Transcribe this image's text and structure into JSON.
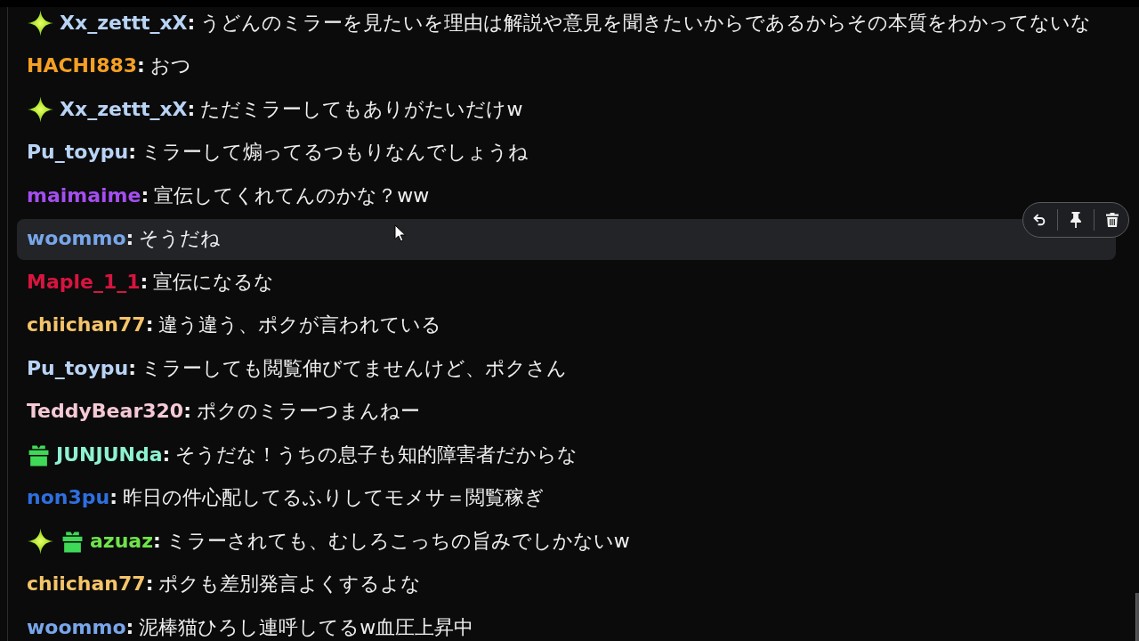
{
  "messages": [
    {
      "badges": [
        {
          "kind": "sparkle"
        }
      ],
      "user": "Xx_zettt_xX",
      "separator": ":",
      "color": "#b9d3f5",
      "text": "うどんのミラーを見たいを理由は解説や意見を聞きたいからであるからその本質をわかってないな",
      "hovered": false
    },
    {
      "user": "HACHI883",
      "separator": ":",
      "color": "#f5a023",
      "text": "おつ",
      "hovered": false
    },
    {
      "badges": [
        {
          "kind": "sparkle"
        }
      ],
      "user": "Xx_zettt_xX",
      "separator": ":",
      "color": "#b9d3f5",
      "text": "ただミラーしてもありがたいだけw",
      "hovered": false
    },
    {
      "user": "Pu_toypu",
      "separator": ":",
      "color": "#b9d3f5",
      "text": "ミラーして煽ってるつもりなんでしょうね",
      "hovered": false
    },
    {
      "user": "maimaime",
      "separator": ":",
      "color": "#a44ef0",
      "text": "宣伝してくれてんのかな？ww",
      "hovered": false
    },
    {
      "user": "woommo",
      "separator": ":",
      "color": "#78a6ea",
      "text": "そうだね",
      "hovered": true
    },
    {
      "user": "Maple_1_1",
      "separator": ":",
      "color": "#d81440",
      "text": "宣伝になるな",
      "hovered": false
    },
    {
      "user": "chiichan77",
      "separator": ":",
      "color": "#f5c46a",
      "text": "違う違う、ポクが言われている",
      "hovered": false
    },
    {
      "user": "Pu_toypu",
      "separator": ":",
      "color": "#b9d3f5",
      "text": "ミラーしても閲覧伸びてませんけど、ポクさん",
      "hovered": false
    },
    {
      "user": "TeddyBear320",
      "separator": ":",
      "color": "#f5c9d5",
      "text": "ポクのミラーつまんねー",
      "hovered": false
    },
    {
      "badges": [
        {
          "kind": "gift"
        }
      ],
      "user": "JUNJUNda",
      "separator": ":",
      "color": "#8ef2d2",
      "text": "そうだな！うちの息子も知的障害者だからな",
      "hovered": false
    },
    {
      "user": "non3pu",
      "separator": ":",
      "color": "#2e6fe0",
      "text": "昨日の件心配してるふりしてモメサ＝閲覧稼ぎ",
      "hovered": false
    },
    {
      "badges": [
        {
          "kind": "sparkle"
        },
        {
          "kind": "gift"
        }
      ],
      "user": "azuaz",
      "separator": ":",
      "color": "#6fe34b",
      "text": "ミラーされても、むしろこっちの旨みでしかないw",
      "hovered": false
    },
    {
      "user": "chiichan77",
      "separator": ":",
      "color": "#f5c46a",
      "text": "ポクも差別発言よくするよな",
      "hovered": false
    },
    {
      "user": "woommo",
      "separator": ":",
      "color": "#78a6ea",
      "text": "泥棒猫ひろし連呼してるw血圧上昇中",
      "hovered": false
    }
  ],
  "message_actions": [
    {
      "kind": "reply"
    },
    {
      "kind": "pin"
    },
    {
      "kind": "delete"
    }
  ]
}
